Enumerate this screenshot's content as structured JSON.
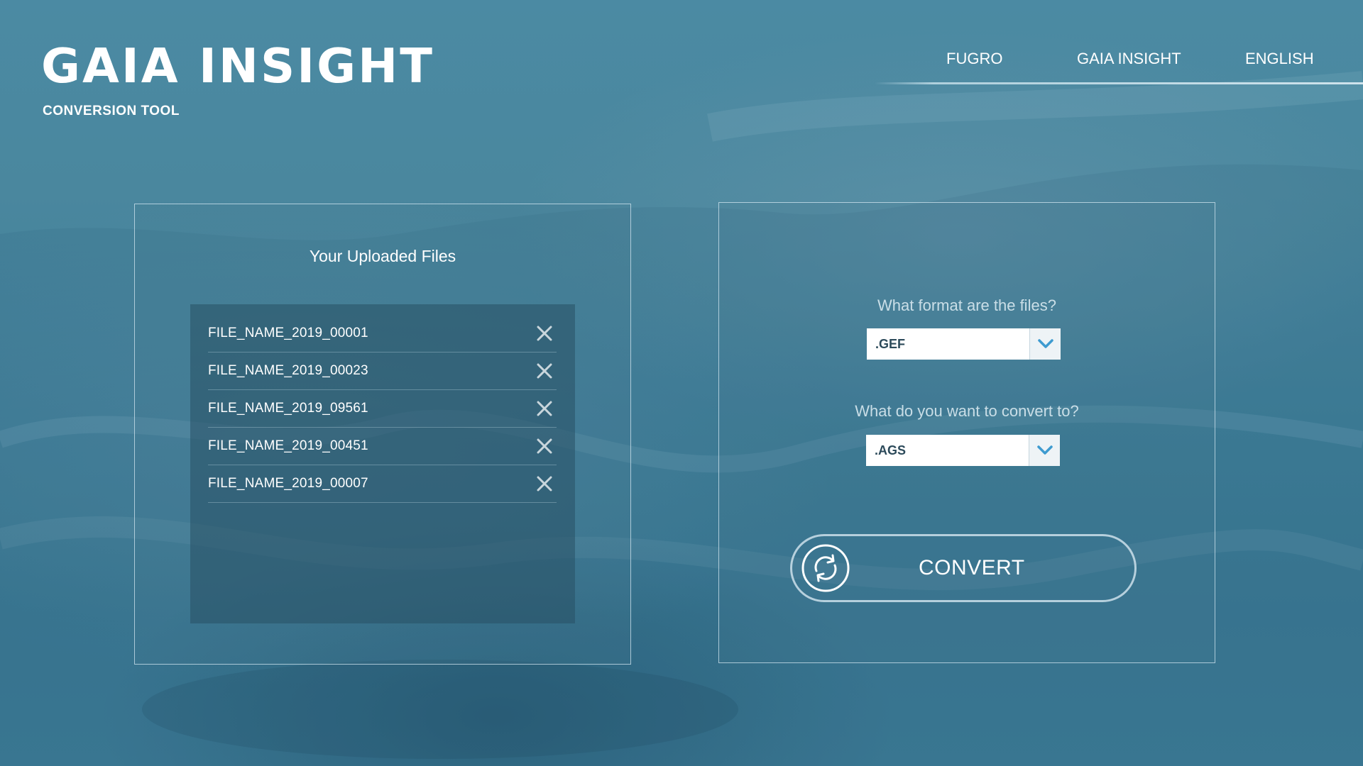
{
  "header": {
    "logo_title": "GAIA INSIGHT",
    "logo_subtitle": "CONVERSION TOOL",
    "nav": [
      {
        "label": "FUGRO"
      },
      {
        "label": "GAIA INSIGHT"
      },
      {
        "label": "ENGLISH"
      }
    ]
  },
  "uploaded_files": {
    "title": "Your Uploaded Files",
    "files": [
      {
        "name": "FILE_NAME_2019_00001"
      },
      {
        "name": "FILE_NAME_2019_00023"
      },
      {
        "name": "FILE_NAME_2019_09561"
      },
      {
        "name": "FILE_NAME_2019_00451"
      },
      {
        "name": "FILE_NAME_2019_00007"
      }
    ],
    "remove_icon": "close-icon"
  },
  "conversion": {
    "source_question": "What format are the files?",
    "source_value": ".GEF",
    "target_question": "What do you want to convert to?",
    "target_value": ".AGS",
    "dropdown_icon": "chevron-down-icon",
    "convert_label": "CONVERT",
    "convert_icon": "refresh-icon"
  },
  "colors": {
    "background": "#4a879e",
    "accent": "#3e9bd0",
    "text": "#ffffff",
    "select_text": "#2c4a5a"
  }
}
